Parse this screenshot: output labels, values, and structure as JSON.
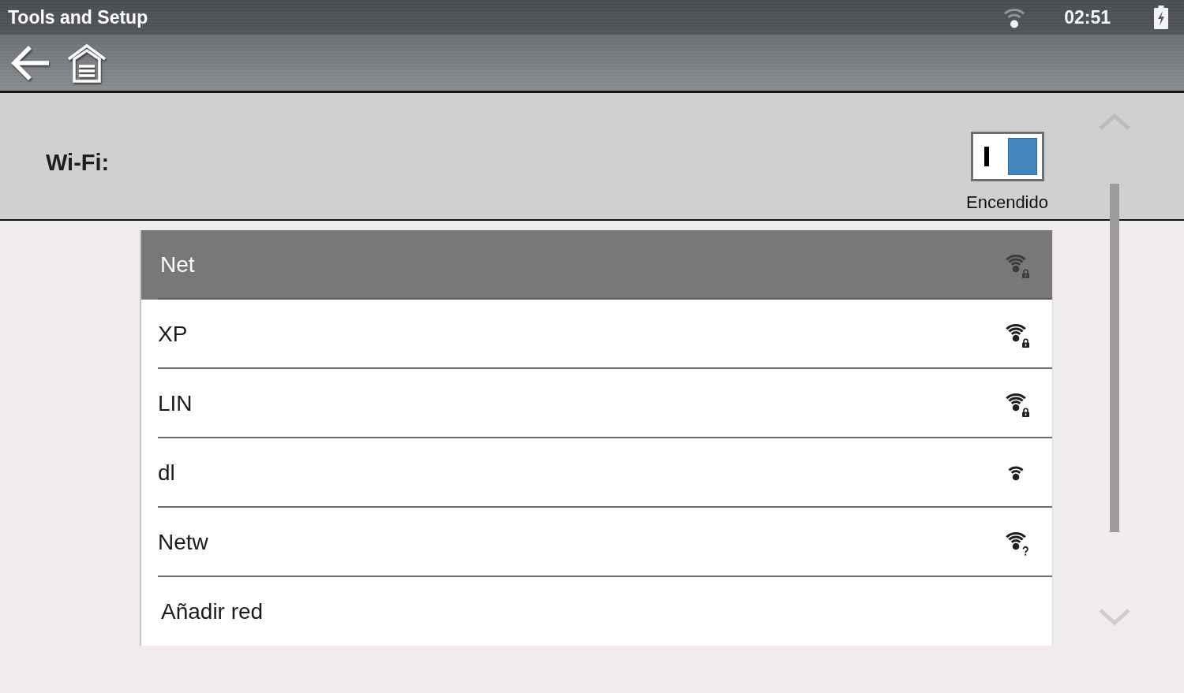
{
  "status_bar": {
    "title": "Tools and Setup",
    "time": "02:51"
  },
  "wifi": {
    "label": "Wi-Fi:",
    "on": true,
    "state_label": "Encendido"
  },
  "networks": [
    {
      "kind": "secured",
      "name": "Net",
      "selected": true
    },
    {
      "kind": "secured",
      "name": "XP",
      "selected": false
    },
    {
      "kind": "secured",
      "name": "LIN",
      "selected": false
    },
    {
      "kind": "open",
      "name": "dl",
      "selected": false
    },
    {
      "kind": "unverified",
      "name": "Netw",
      "selected": false
    },
    {
      "kind": "add",
      "name": "Añadir red",
      "selected": false
    }
  ]
}
